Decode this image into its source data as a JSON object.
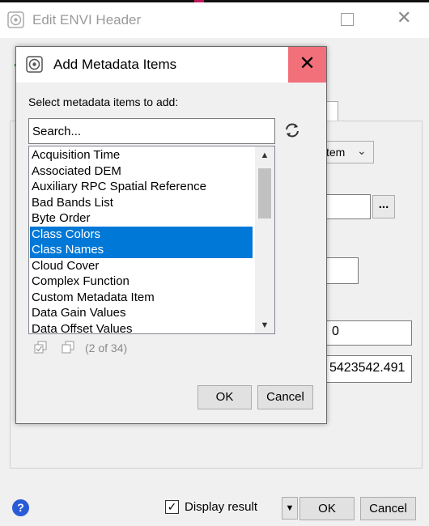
{
  "parent_window": {
    "title": "Edit ENVI Header",
    "tab_label": "m",
    "select_value": "tem",
    "browse_label": "...",
    "field_value_1": "0",
    "field_value_2": "5423542.491",
    "display_result_label": "Display result",
    "display_result_checked": "✓",
    "ok_label": "OK",
    "cancel_label": "Cancel",
    "help_label": "?",
    "colors": {
      "help_icon": "#2a5bd7"
    }
  },
  "dialog": {
    "title": "Add Metadata Items",
    "instruction": "Select metadata items to add:",
    "search_placeholder": "Search...",
    "items": [
      {
        "label": "Acquisition Time",
        "selected": false
      },
      {
        "label": "Associated DEM",
        "selected": false
      },
      {
        "label": "Auxiliary RPC Spatial Reference",
        "selected": false
      },
      {
        "label": "Bad Bands List",
        "selected": false
      },
      {
        "label": "Byte Order",
        "selected": false
      },
      {
        "label": "Class Colors",
        "selected": true
      },
      {
        "label": "Class Names",
        "selected": true
      },
      {
        "label": "Cloud Cover",
        "selected": false
      },
      {
        "label": "Complex Function",
        "selected": false
      },
      {
        "label": "Custom Metadata Item",
        "selected": false
      },
      {
        "label": "Data Gain Values",
        "selected": false
      },
      {
        "label": "Data Offset Values",
        "selected": false
      }
    ],
    "selection_count": "(2 of 34)",
    "ok_label": "OK",
    "cancel_label": "Cancel",
    "colors": {
      "selection": "#0078d7",
      "close_hover": "#f1707a"
    }
  }
}
